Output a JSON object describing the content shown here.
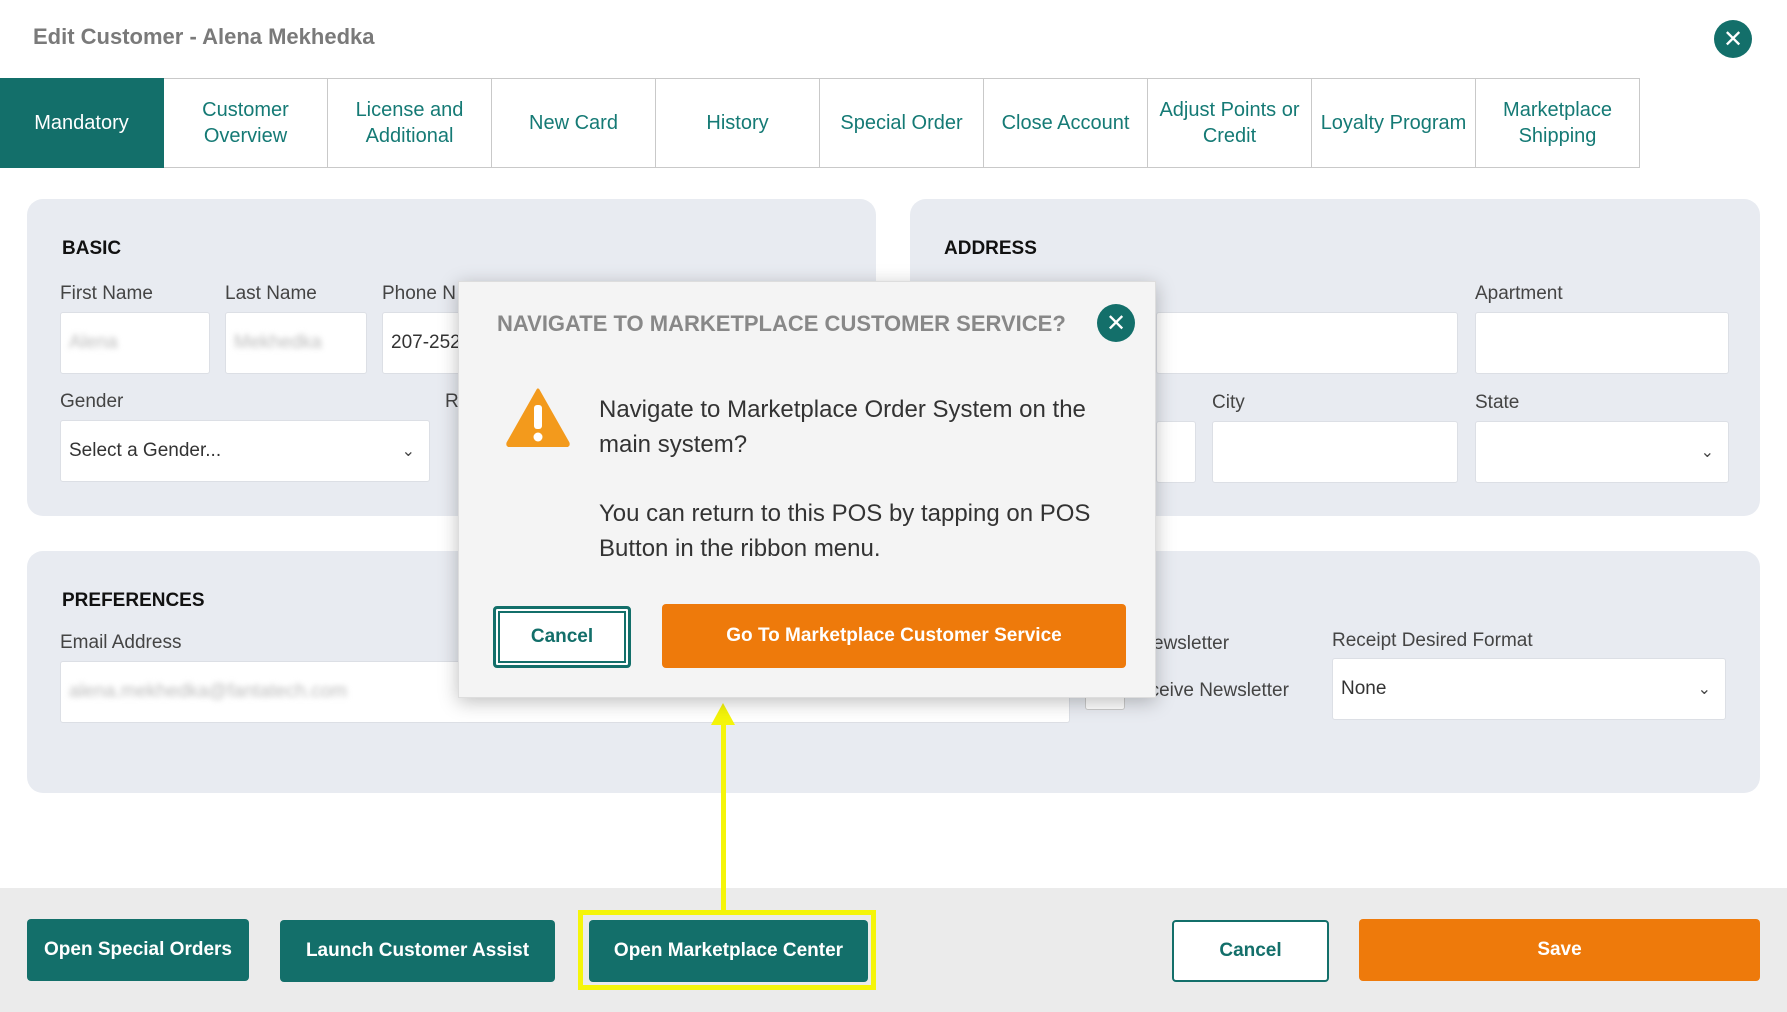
{
  "header": {
    "title": "Edit Customer - Alena Mekhedka"
  },
  "tabs": [
    {
      "label": "Mandatory"
    },
    {
      "label": "Customer Overview"
    },
    {
      "label": "License and Additional"
    },
    {
      "label": "New Card"
    },
    {
      "label": "History"
    },
    {
      "label": "Special Order"
    },
    {
      "label": "Close Account"
    },
    {
      "label": "Adjust Points or Credit"
    },
    {
      "label": "Loyalty Program"
    },
    {
      "label": "Marketplace Shipping"
    }
  ],
  "basic": {
    "heading": "BASIC",
    "first_name_label": "First Name",
    "first_name_value": "Alena",
    "last_name_label": "Last Name",
    "last_name_value": "Mekhedka",
    "phone_label": "Phone N",
    "phone_value": "207-252",
    "gender_label": "Gender",
    "gender_value": "Select a Gender...",
    "r_label": "R"
  },
  "address": {
    "heading": "ADDRESS",
    "apartment_label": "Apartment",
    "city_label": "City",
    "state_label": "State"
  },
  "preferences": {
    "heading": "PREFERENCES",
    "email_label": "Email Address",
    "email_value": "alena.mekhedka@fantatech.com",
    "newsletter_label": "ewsletter",
    "receive_newsletter_label": "eceive Newsletter",
    "receipt_format_label": "Receipt Desired Format",
    "receipt_format_value": "None"
  },
  "footer": {
    "open_special_orders": "Open Special Orders",
    "launch_customer_assist": "Launch Customer Assist",
    "open_marketplace_center": "Open Marketplace Center",
    "cancel": "Cancel",
    "save": "Save"
  },
  "modal": {
    "title": "NAVIGATE TO MARKETPLACE CUSTOMER SERVICE?",
    "message_line1": "Navigate to Marketplace Order System on the main system?",
    "message_line2": "You can return to this POS by tapping on POS Button in the ribbon menu.",
    "cancel": "Cancel",
    "confirm": "Go To Marketplace Customer Service"
  },
  "icons": {
    "close": "close-icon",
    "warning": "warning-icon",
    "chevron": "chevron-down-icon"
  },
  "colors": {
    "teal": "#136f6a",
    "orange": "#ee7a0b",
    "highlight": "#f5f50a",
    "panel": "#e8ebf1"
  }
}
